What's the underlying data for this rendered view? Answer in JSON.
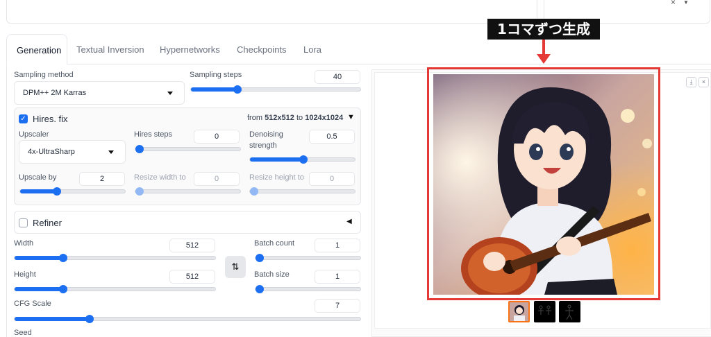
{
  "tabs": [
    "Generation",
    "Textual Inversion",
    "Hypernetworks",
    "Checkpoints",
    "Lora"
  ],
  "top_right_select": {
    "clear_icon": "×",
    "arrow_icon": "chevron-down-icon"
  },
  "sampling": {
    "method_label": "Sampling method",
    "method_value": "DPM++ 2M Karras",
    "steps_label": "Sampling steps",
    "steps_value": "40",
    "steps_fraction": 0.27
  },
  "hires": {
    "label": "Hires. fix",
    "checked": true,
    "from_text": "from",
    "from_value": "512x512",
    "to_text": "to",
    "to_value": "1024x1024",
    "upscaler_label": "Upscaler",
    "upscaler_value": "4x-UltraSharp",
    "steps_label": "Hires steps",
    "steps_value": "0",
    "denoise_label_1": "Denoising",
    "denoise_label_2": "strength",
    "denoise_value": "0.5",
    "upscale_by_label": "Upscale by",
    "upscale_by_value": "2",
    "resize_w_label": "Resize width to",
    "resize_w_value": "0",
    "resize_h_label": "Resize height to",
    "resize_h_value": "0"
  },
  "refiner": {
    "label": "Refiner",
    "checked": false
  },
  "size": {
    "width_label": "Width",
    "width_value": "512",
    "height_label": "Height",
    "height_value": "512",
    "swap_icon": "⇅"
  },
  "batch": {
    "count_label": "Batch count",
    "count_value": "1",
    "size_label": "Batch size",
    "size_value": "1"
  },
  "cfg": {
    "label": "CFG Scale",
    "value": "7"
  },
  "seed": {
    "label": "Seed"
  },
  "annotation": {
    "text": "1コマずつ生成"
  },
  "gallery": {
    "download_icon": "⤓",
    "close_icon": "×",
    "thumb_count": 3
  }
}
